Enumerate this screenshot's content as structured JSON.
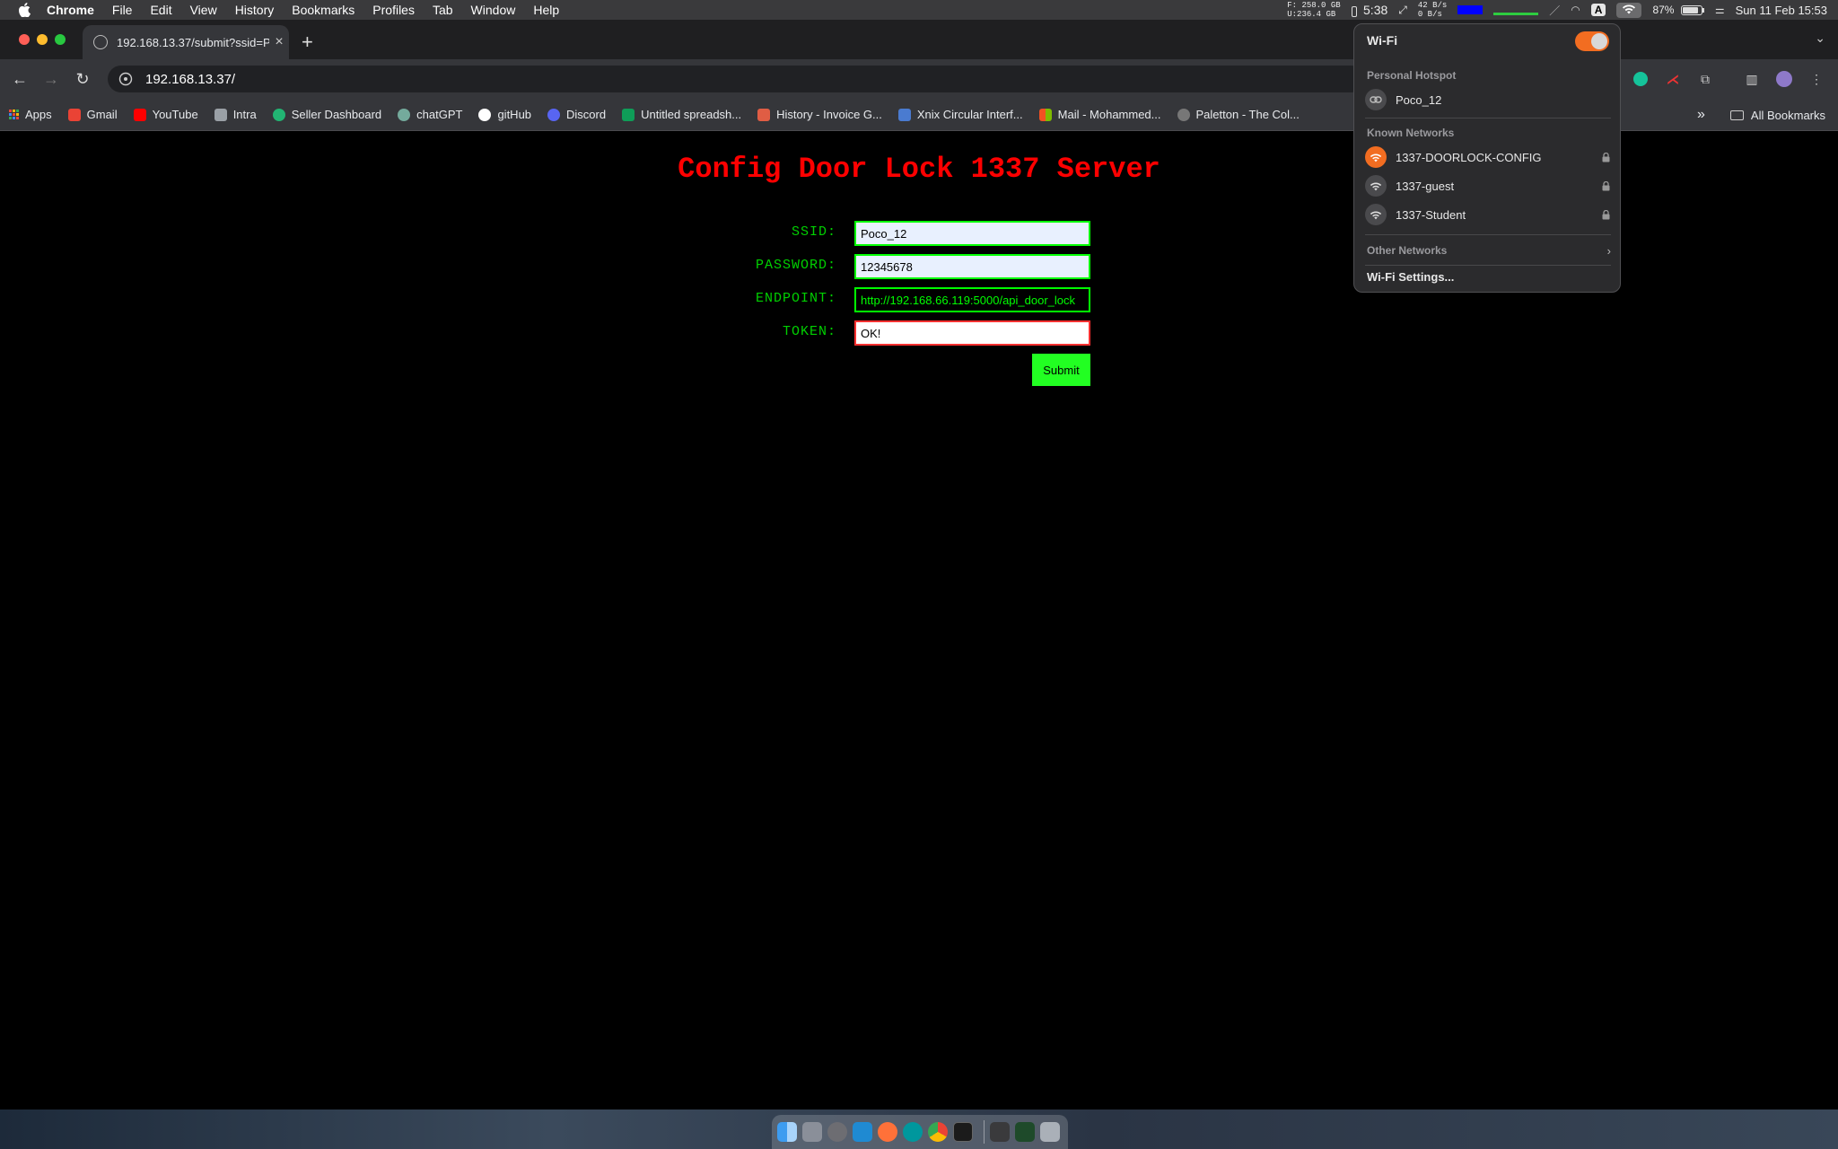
{
  "menubar": {
    "items": [
      "Chrome",
      "File",
      "Edit",
      "View",
      "History",
      "Bookmarks",
      "Profiles",
      "Tab",
      "Window",
      "Help"
    ],
    "status": {
      "disk_free": "F: 258.0 GB",
      "disk_used": "U:236.4 GB",
      "battery_time": "5:38",
      "net_up": "42 B/s",
      "net_down": "0 B/s",
      "input_source": "A",
      "battery_percent": "87%",
      "clock": "Sun 11 Feb 15:53"
    }
  },
  "tab": {
    "title": "192.168.13.37/submit?ssid=P",
    "close": "×",
    "new_tab": "+"
  },
  "toolbar": {
    "url": "192.168.13.37/"
  },
  "bookmarks": {
    "items": [
      {
        "label": "Apps",
        "color": "#e8453c"
      },
      {
        "label": "Gmail",
        "color": "#ea4335"
      },
      {
        "label": "YouTube",
        "color": "#ff0000"
      },
      {
        "label": "Intra",
        "color": "#9aa0a6"
      },
      {
        "label": "Seller Dashboard",
        "color": "#22b573"
      },
      {
        "label": "chatGPT",
        "color": "#74aa9c"
      },
      {
        "label": "gitHub",
        "color": "#ffffff"
      },
      {
        "label": "Discord",
        "color": "#5865f2"
      },
      {
        "label": "Untitled spreadsh...",
        "color": "#0f9d58"
      },
      {
        "label": "History - Invoice G...",
        "color": "#e05d44"
      },
      {
        "label": "Xnix Circular Interf...",
        "color": "#4a7bd0"
      },
      {
        "label": "Mail - Mohammed...",
        "color": "#f25022"
      },
      {
        "label": "Paletton - The Col...",
        "color": "#777777"
      }
    ],
    "overflow": "»",
    "all_bookmarks": "All Bookmarks"
  },
  "page": {
    "title": "Config Door Lock 1337 Server",
    "fields": {
      "ssid_label": "SSID:",
      "ssid_value": "Poco_12",
      "password_label": "PASSWORD:",
      "password_value": "12345678",
      "endpoint_label": "ENDPOINT:",
      "endpoint_value": "http://192.168.66.119:5000/api_door_lock",
      "token_label": "TOKEN:",
      "token_value": "OK!"
    },
    "submit_label": "Submit"
  },
  "wifi_menu": {
    "title": "Wi-Fi",
    "personal_hotspot_header": "Personal Hotspot",
    "hotspot_name": "Poco_12",
    "known_networks_header": "Known Networks",
    "known_networks": [
      "1337-DOORLOCK-CONFIG",
      "1337-guest",
      "1337-Student"
    ],
    "other_networks": "Other Networks",
    "settings": "Wi-Fi Settings..."
  }
}
